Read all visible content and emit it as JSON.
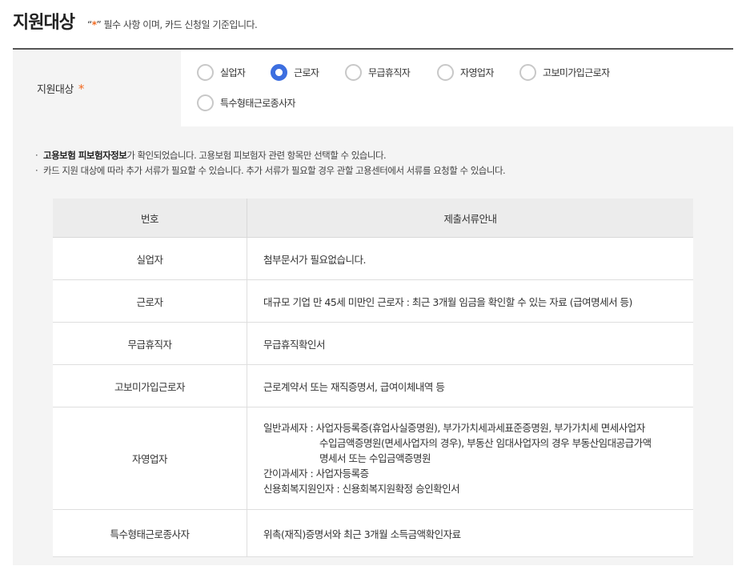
{
  "header": {
    "title": "지원대상",
    "note_open_quote": "“",
    "note_star": "*",
    "note_close_quote": "”",
    "note_text": " 필수 사항 이며, 카드 신청일 기준입니다."
  },
  "form": {
    "label": "지원대상",
    "required_star": "*",
    "options": [
      {
        "label": "실업자",
        "checked": false
      },
      {
        "label": "근로자",
        "checked": true
      },
      {
        "label": "무급휴직자",
        "checked": false
      },
      {
        "label": "자영업자",
        "checked": false
      },
      {
        "label": "고보미가입근로자",
        "checked": false
      },
      {
        "label": "특수형태근로종사자",
        "checked": false
      }
    ],
    "accent_color": "#3d6fe0",
    "star_color": "#f26a21"
  },
  "notices": [
    {
      "dot": "·",
      "bold": "고용보험 피보험자정보",
      "text": "가 확인되었습니다. 고용보험 피보험자 관련 항목만 선택할 수 있습니다."
    },
    {
      "dot": "·",
      "bold": "",
      "text": "카드 지원 대상에 따라 추가 서류가 필요할 수 있습니다. 추가 서류가 필요할 경우 관할 고용센터에서 서류를 요청할 수 있습니다."
    }
  ],
  "table": {
    "headers": [
      "번호",
      "제출서류안내"
    ],
    "rows": [
      {
        "type": "실업자",
        "lines": [
          "첨부문서가 필요없습니다."
        ]
      },
      {
        "type": "근로자",
        "lines": [
          "대규모 기업 만 45세 미만인 근로자 : 최근 3개월 임금을 확인할 수 있는 자료 (급여명세서 등)"
        ]
      },
      {
        "type": "무급휴직자",
        "lines": [
          "무급휴직확인서"
        ]
      },
      {
        "type": "고보미가입근로자",
        "lines": [
          "근로계약서 또는 재직증명서, 급여이체내역 등"
        ]
      },
      {
        "type": "자영업자",
        "lines": [
          "일반과세자 : 사업자등록증(휴업사실증명원), 부가가치세과세표준증명원, 부가가치세 면세사업자",
          "수입금액증명원(면세사업자의 경우), 부동산 임대사업자의 경우 부동산임대공급가액",
          "명세서 또는 수입금액증명원",
          "간이과세자 : 사업자등록증",
          "신용회복지원인자 : 신용회복지원확정 승인확인서"
        ]
      },
      {
        "type": "특수형태근로종사자",
        "lines": [
          "위촉(재직)증명서와 최근 3개월 소득금액확인자료"
        ]
      }
    ]
  }
}
